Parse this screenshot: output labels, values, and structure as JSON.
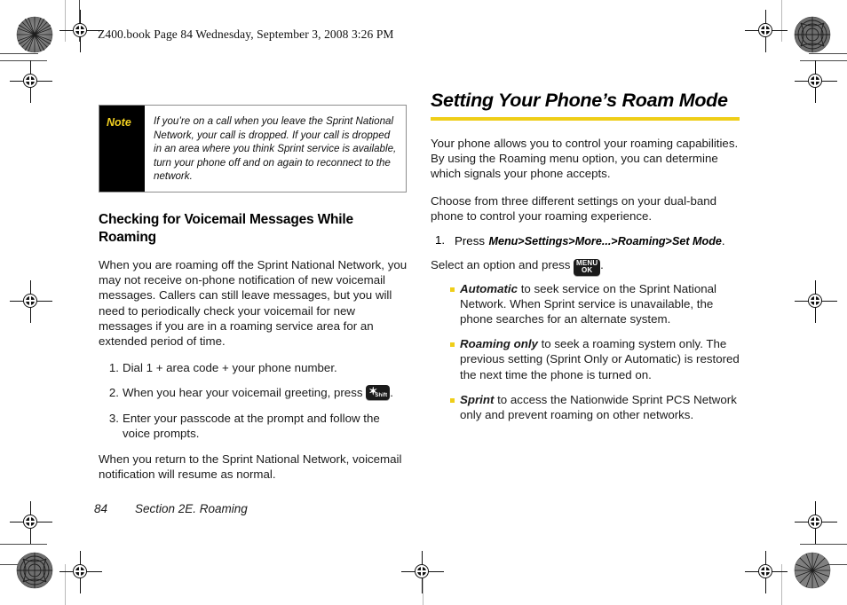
{
  "document": {
    "running_head": "Z400.book  Page 84  Wednesday, September 3, 2008  3:26 PM",
    "footer": {
      "page_number": "84",
      "section": "Section 2E. Roaming"
    }
  },
  "colors": {
    "accent_yellow": "#EFCE18",
    "note_label_yellow": "#F2D021",
    "note_panel_black": "#000000",
    "body_text": "#1a1a1a"
  },
  "left_column": {
    "note": {
      "label": "Note",
      "text": "If you’re on a call when you leave the Sprint National Network, your call is dropped. If your call is dropped in an area where you think Sprint service is available, turn your phone off and on again to reconnect to the network."
    },
    "subheading": "Checking for Voicemail Messages While Roaming",
    "intro_paragraph": "When you are roaming off the Sprint National Network, you may not receive on-phone notification of new voicemail messages. Callers can still leave messages, but you will need to periodically check your voicemail for new messages if you are in a roaming service area for an extended period of time.",
    "steps": [
      {
        "text": "Dial 1 + area code + your phone number."
      },
      {
        "text_before": "When you hear your voicemail greeting, press",
        "key": {
          "name": "star-shift-key",
          "glyph": "✶",
          "label": "Shift"
        },
        "text_after": "."
      },
      {
        "text": "Enter your passcode at the prompt and follow the voice prompts."
      }
    ],
    "closing_paragraph": "When you return to the Sprint National Network, voicemail notification will resume as normal."
  },
  "right_column": {
    "heading": "Setting Your Phone’s Roam Mode",
    "paragraph_1": "Your phone allows you to control your roaming capabilities. By using the Roaming menu option, you can determine which signals your phone accepts.",
    "paragraph_2": "Choose from three different settings on your dual-band phone to control your roaming experience.",
    "step_1": {
      "number": "1.",
      "lead": "Press",
      "menu_path": [
        "Menu",
        "Settings",
        "More...",
        "Roaming",
        "Set Mode"
      ],
      "separator": ">",
      "trailing": "."
    },
    "select_line": {
      "text_before": "Select an option and press",
      "key": {
        "name": "menu-ok-key",
        "line1": "MENU",
        "line2": "OK"
      },
      "text_after": "."
    },
    "options": [
      {
        "term": "Automatic",
        "description": " to seek service on the Sprint National Network. When Sprint service is unavailable, the phone searches for an alternate system."
      },
      {
        "term": "Roaming only",
        "description": " to seek a roaming system only. The previous setting (Sprint Only or Automatic) is restored the next time the phone is turned on."
      },
      {
        "term": "Sprint",
        "description": " to access the Nationwide Sprint PCS Network only and prevent roaming on other networks."
      }
    ]
  }
}
